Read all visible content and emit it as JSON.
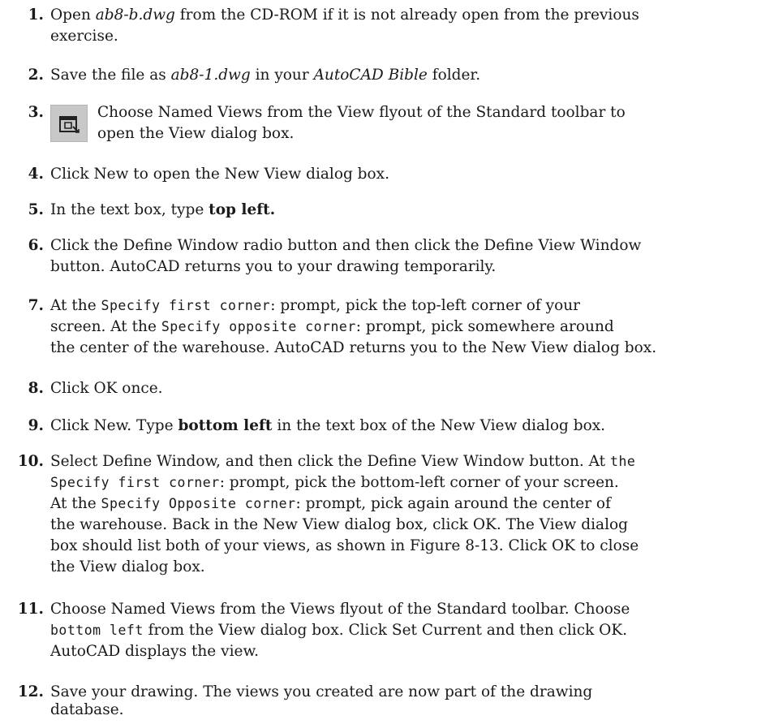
{
  "steps": [
    {
      "number": "1.",
      "parts": [
        "Open ",
        "ab8-b.dwg",
        " from the CD-ROM if it is not already open from the previous",
        "exercise."
      ]
    },
    {
      "number": "2.",
      "parts": [
        "Save the file as ",
        "ab8-1.dwg",
        " in your ",
        "AutoCAD Bible",
        " folder."
      ]
    },
    {
      "number": "3.",
      "icon": "named-views-icon",
      "lines": [
        "Choose Named Views from the View flyout of the Standard toolbar to",
        "open the View dialog box."
      ]
    },
    {
      "number": "4.",
      "text": "Click New to open the New View dialog box."
    },
    {
      "number": "5.",
      "parts": [
        "In the text box, type ",
        "top left."
      ]
    },
    {
      "number": "6.",
      "lines": [
        "Click the Define Window radio button and then click the Define View Window",
        "button. AutoCAD returns you to your drawing temporarily."
      ]
    },
    {
      "number": "7.",
      "parts": [
        "At the ",
        "Specify first corner",
        ": prompt, pick the top-left corner of your",
        "screen. At the ",
        "Specify opposite corner",
        ": prompt, pick somewhere around",
        "the center of the warehouse. AutoCAD returns you to the New View dialog box."
      ]
    },
    {
      "number": "8.",
      "text": "Click OK once."
    },
    {
      "number": "9.",
      "parts": [
        "Click New. Type ",
        "bottom left",
        " in the text box of the New View dialog box."
      ]
    },
    {
      "number": "10.",
      "parts": [
        "Select Define Window, and then click the Define View Window button. At ",
        "the",
        "Specify first corner",
        ": prompt, pick the bottom-left corner of your screen.",
        "At the ",
        "Specify Opposite corner",
        ": prompt, pick again around the center of",
        "the warehouse. Back in the New View dialog box, click OK. The View dialog",
        "box should list both of your views, as shown in Figure 8-13. Click OK to close",
        "the View dialog box."
      ]
    },
    {
      "number": "11.",
      "parts": [
        "Choose Named Views from the Views flyout of the Standard toolbar. Choose",
        "bottom left",
        " from the View dialog box. Click Set Current and then click OK.",
        "AutoCAD displays the view."
      ]
    },
    {
      "number": "12.",
      "lines": [
        "Save your drawing. The views you created are now part of the drawing",
        "database."
      ]
    }
  ],
  "colors": {
    "icon_bg": "#c8c8c8",
    "text": "#1a1a1a"
  }
}
